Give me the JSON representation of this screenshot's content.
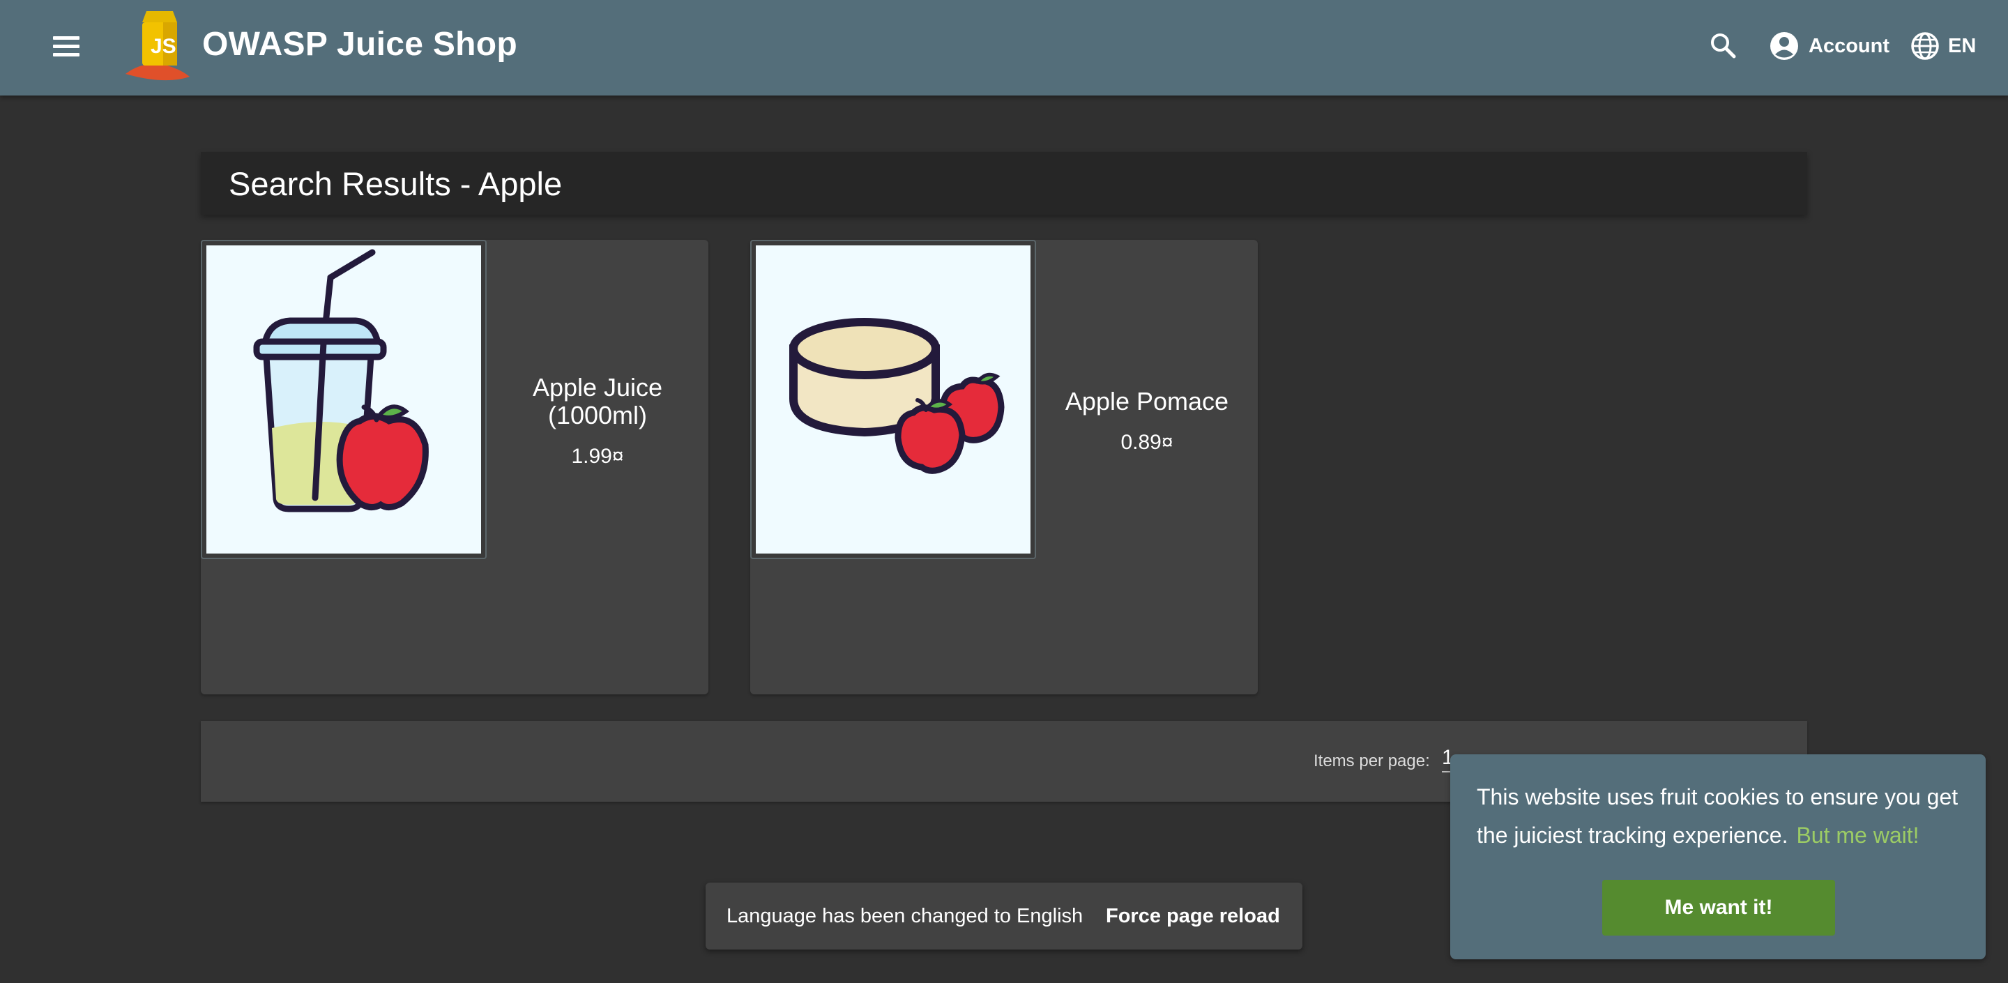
{
  "header": {
    "app_title": "OWASP Juice Shop",
    "menu_icon": "menu-icon",
    "search_icon": "search-icon",
    "account_label": "Account",
    "account_icon": "account-circle-icon",
    "language_label": "EN",
    "language_icon": "globe-icon",
    "background_color": "#546e7a"
  },
  "results": {
    "title": "Search Results - Apple"
  },
  "products": [
    {
      "name": "Apple Juice (1000ml)",
      "price": "1.99¤",
      "image": "juice-cup-with-apple"
    },
    {
      "name": "Apple Pomace",
      "price": "0.89¤",
      "image": "pomace-cake-with-apples"
    }
  ],
  "paginator": {
    "items_per_page_label": "Items per page:",
    "items_per_page_value": "1"
  },
  "snackbar": {
    "message": "Language has been changed to English",
    "action": "Force page reload"
  },
  "cookie_banner": {
    "message": "This website uses fruit cookies to ensure you get the juiciest tracking experience.",
    "link": "But me wait!",
    "button": "Me want it!",
    "button_color": "#558b2f",
    "link_color": "#9ccc65"
  },
  "colors": {
    "page_background": "#303030",
    "card_background": "#424242"
  }
}
